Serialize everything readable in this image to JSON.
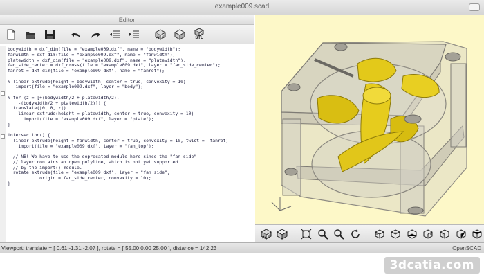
{
  "window": {
    "title": "example009.scad"
  },
  "editor": {
    "header": "Editor",
    "toolbar_icons": [
      "new-file-icon",
      "open-file-icon",
      "save-icon",
      "undo-icon",
      "redo-icon",
      "unindent-icon",
      "indent-icon",
      "preview-icon",
      "render-icon",
      "export-stl-icon"
    ],
    "stl_label": "STL",
    "code_lines": [
      "bodywidth = dxf_dim(file = \"example009.dxf\", name = \"bodywidth\");",
      "fanwidth = dxf_dim(file = \"example009.dxf\", name = \"fanwidth\");",
      "platewidth = dxf_dim(file = \"example009.dxf\", name = \"platewidth\");",
      "fan_side_center = dxf_cross(file = \"example009.dxf\", layer = \"fan_side_center\");",
      "fanrot = dxf_dim(file = \"example009.dxf\", name = \"fanrot\");",
      "",
      "% linear_extrude(height = bodywidth, center = true, convexity = 10)",
      "   import(file = \"example009.dxf\", layer = \"body\");",
      "",
      "% for (z = [+(bodywidth/2 + platewidth/2),",
      "    -(bodywidth/2 + platewidth/2)]) {",
      "  translate([0, 0, z])",
      "    linear_extrude(height = platewidth, center = true, convexity = 10)",
      "      import(file = \"example009.dxf\", layer = \"plate\");",
      "}",
      "",
      "intersection() {",
      "  linear_extrude(height = fanwidth, center = true, convexity = 10, twist = -fanrot)",
      "    import(file = \"example009.dxf\", layer = \"fan_top\");",
      "",
      "  // NB! We have to use the deprecated module here since the \"fan_side\"",
      "  // layer contains an open polyline, which is not yet supported",
      "  // by the import() module.",
      "  rotate_extrude(file = \"example009.dxf\", layer = \"fan_side\",",
      "            origin = fan_side_center, convexity = 10);",
      "}"
    ]
  },
  "viewport": {
    "background": "#fdf8c8",
    "toolbar_icons": [
      "render-view-icon",
      "preview-view-icon",
      "view-all-icon",
      "zoom-in-icon",
      "zoom-out-icon",
      "reset-view-icon",
      "view-right-icon",
      "view-top-icon",
      "view-bottom-icon",
      "view-left-icon",
      "view-front-icon",
      "view-back-icon",
      "view-diagonal-icon"
    ]
  },
  "statusbar": {
    "text": "Viewport: translate = [ 0.61 -1.31 -2.07 ], rotate = [ 55.00 0.00 25.00 ], distance = 142.23",
    "app": "OpenSCAD"
  },
  "watermark": "3dcatia.com"
}
